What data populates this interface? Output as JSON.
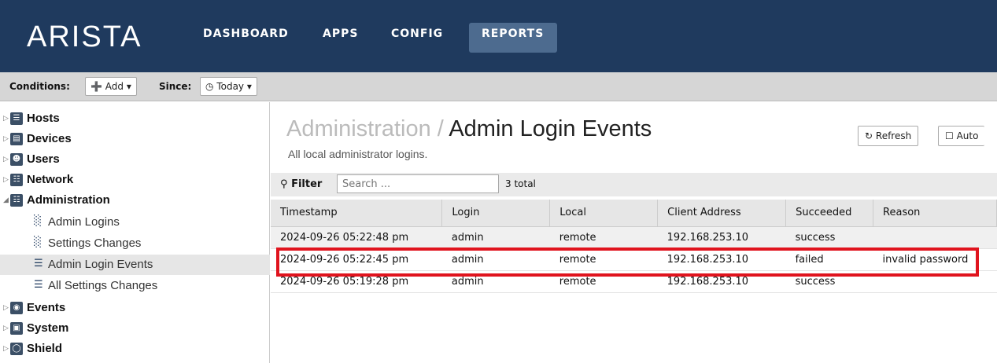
{
  "brand": {
    "logo": "ARISTA"
  },
  "nav": {
    "items": [
      {
        "label": "DASHBOARD"
      },
      {
        "label": "APPS"
      },
      {
        "label": "CONFIG"
      },
      {
        "label": "REPORTS"
      }
    ],
    "active": "REPORTS"
  },
  "conditions": {
    "conditions_label": "Conditions:",
    "add_label": "Add",
    "since_label": "Since:",
    "today_label": "Today"
  },
  "sidebar": {
    "items": [
      {
        "label": "Hosts",
        "icon": "hosts-icon"
      },
      {
        "label": "Devices",
        "icon": "devices-icon"
      },
      {
        "label": "Users",
        "icon": "users-icon"
      },
      {
        "label": "Network",
        "icon": "network-icon"
      },
      {
        "label": "Administration",
        "icon": "administration-icon",
        "expanded": true
      },
      {
        "label": "Events",
        "icon": "events-icon"
      },
      {
        "label": "System",
        "icon": "system-icon"
      },
      {
        "label": "Shield",
        "icon": "shield-icon"
      }
    ],
    "admin_children": [
      {
        "label": "Admin Logins",
        "icon": "bar-chart-icon"
      },
      {
        "label": "Settings Changes",
        "icon": "bar-chart-icon"
      },
      {
        "label": "Admin Login Events",
        "icon": "list-icon",
        "selected": true
      },
      {
        "label": "All Settings Changes",
        "icon": "list-icon"
      }
    ]
  },
  "main": {
    "breadcrumb": "Administration /",
    "title": "Admin Login Events",
    "subtitle": "All local administrator logins.",
    "refresh_label": "Refresh",
    "auto_label": "Auto",
    "filter_label": "Filter",
    "filter_placeholder": "Search ...",
    "total": "3 total"
  },
  "table": {
    "columns": [
      "Timestamp",
      "Login",
      "Local",
      "Client Address",
      "Succeeded",
      "Reason"
    ],
    "rows": [
      [
        "2024-09-26 05:22:48 pm",
        "admin",
        "remote",
        "192.168.253.10",
        "success",
        ""
      ],
      [
        "2024-09-26 05:22:45 pm",
        "admin",
        "remote",
        "192.168.253.10",
        "failed",
        "invalid password"
      ],
      [
        "2024-09-26 05:19:28 pm",
        "admin",
        "remote",
        "192.168.253.10",
        "success",
        ""
      ]
    ],
    "highlight_color": "#e0141e"
  },
  "colors": {
    "header_bg": "#1f3a5e",
    "active_tab": "#4d6b8f"
  }
}
